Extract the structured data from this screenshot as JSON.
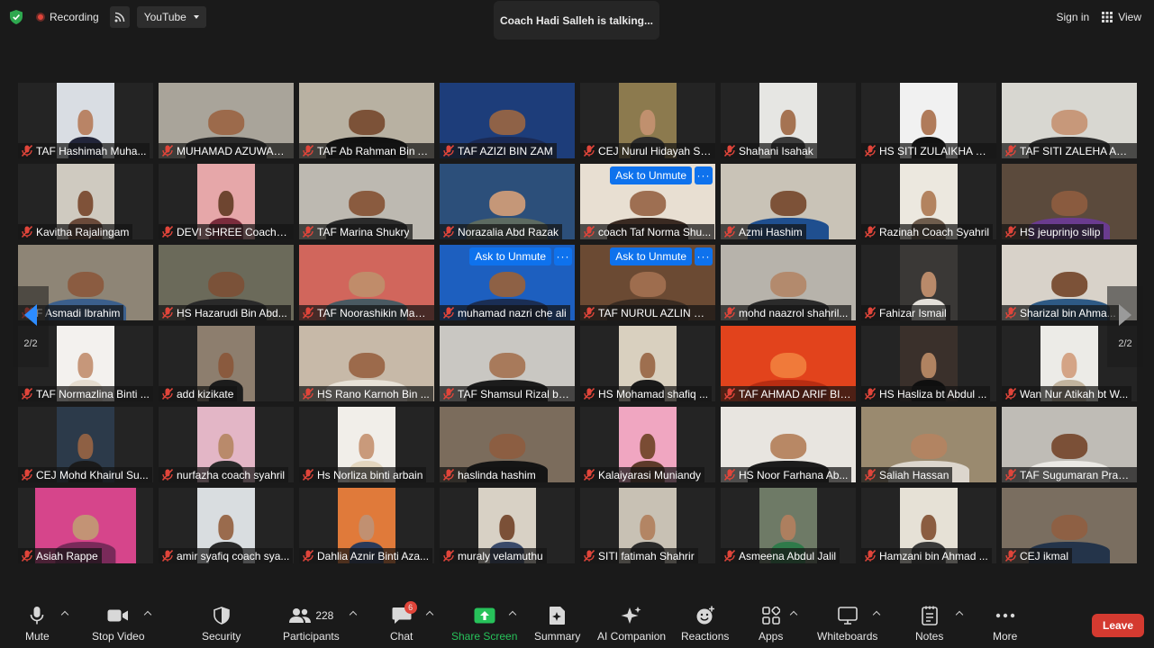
{
  "topbar": {
    "recording_label": "Recording",
    "stream_label": "YouTube",
    "talking": "Coach Hadi Salleh is talking...",
    "signin": "Sign in",
    "view": "View"
  },
  "pager": {
    "left_label": "2/2",
    "right_label": "2/2"
  },
  "tiles": [
    {
      "name": "TAF Hashimah Muha...",
      "w": "w-narrow",
      "bg": "#d9dde3",
      "skin": "#b98466",
      "cloth": "#22253a"
    },
    {
      "name": "MUHAMAD AZUWAN...",
      "w": "w-full",
      "bg": "#a9a49a",
      "skin": "#9c6a4b",
      "cloth": "#2a2a2a"
    },
    {
      "name": "TAF Ab Rahman Bin A...",
      "w": "w-full",
      "bg": "#b8b1a2",
      "skin": "#7c5238",
      "cloth": "#111111"
    },
    {
      "name": "TAF AZIZI BIN ZAM",
      "w": "w-full",
      "bg": "#1d3d7a",
      "skin": "#8f6247",
      "cloth": "#1a2a55"
    },
    {
      "name": "CEJ Nurul Hidayah Su...",
      "w": "w-narrow",
      "bg": "#8c7a4e",
      "skin": "#c0906e",
      "cloth": "#2b2b2b"
    },
    {
      "name": "Shahani Isahak",
      "w": "w-narrow",
      "bg": "#e6e6e3",
      "skin": "#a57352",
      "cloth": "#3b3b3b"
    },
    {
      "name": "HS SITI ZULAIKHA MA...",
      "w": "w-narrow",
      "bg": "#f1f1f1",
      "skin": "#b07b5a",
      "cloth": "#121212"
    },
    {
      "name": "TAF SITI ZALEHA ABD...",
      "w": "w-full",
      "bg": "#d8d7d1",
      "skin": "#c7987a",
      "cloth": "#2c2c2c"
    },
    {
      "name": "Kavitha Rajalingam",
      "w": "w-narrow",
      "bg": "#cfcac0",
      "skin": "#7f5239",
      "cloth": "#6b4a3a"
    },
    {
      "name": "DEVI  SHREE Coach S...",
      "w": "w-narrow",
      "bg": "#e6a7a9",
      "skin": "#6e4530",
      "cloth": "#7a2c3c"
    },
    {
      "name": "TAF Marina Shukry",
      "w": "w-full",
      "bg": "#bdb9b1",
      "skin": "#8a5b3f",
      "cloth": "#2b2b2b"
    },
    {
      "name": "Norazalia Abd Razak",
      "w": "w-full",
      "bg": "#2c4f7a",
      "skin": "#c59778",
      "cloth": "#5d6b61"
    },
    {
      "name": "coach Taf Norma Shu...",
      "w": "w-full",
      "bg": "#e8dfd2",
      "skin": "#9e6f52",
      "cloth": "#3a2a22",
      "unmute": true
    },
    {
      "name": "Azmi Hashim",
      "w": "w-full",
      "bg": "#c9c3b7",
      "skin": "#7d5238",
      "cloth": "#1f4f8f"
    },
    {
      "name": "Razinah Coach Syahril",
      "w": "w-narrow",
      "bg": "#ece8df",
      "skin": "#b3835f",
      "cloth": "#6f5d4d"
    },
    {
      "name": "HS jeuprinjo silip",
      "w": "w-full",
      "bg": "#5b4a3c",
      "skin": "#8a5b3f",
      "cloth": "#6a3b8f"
    },
    {
      "name": "F Asmadi Ibrahim",
      "w": "w-full",
      "bg": "#8e8576",
      "skin": "#8b5c41",
      "cloth": "#3b5f8c"
    },
    {
      "name": "HS Hazarudi Bin Abd...",
      "w": "w-full",
      "bg": "#6b6a5a",
      "skin": "#7b5239",
      "cloth": "#2a2a2a"
    },
    {
      "name": "TAF Noorashikin Mazl...",
      "w": "w-full",
      "bg": "#d1665c",
      "skin": "#c08c6a",
      "cloth": "#4a5a62"
    },
    {
      "name": "muhamad nazri che ali",
      "w": "w-full",
      "bg": "#1d5fbf",
      "skin": "#8e6145",
      "cloth": "#1a2e55",
      "unmute": true
    },
    {
      "name": "TAF NURUL AZLIN BT ...",
      "w": "w-full",
      "bg": "#6b4a33",
      "skin": "#9e6d4e",
      "cloth": "#3a2c22",
      "unmute": true
    },
    {
      "name": "mohd naazrol shahril...",
      "w": "w-full",
      "bg": "#b7b3ab",
      "skin": "#b38a6d",
      "cloth": "#2b2b2b"
    },
    {
      "name": "Fahizar Ismail",
      "w": "w-narrow",
      "bg": "#3a3836",
      "skin": "#b98a6a",
      "cloth": "#e4e0da"
    },
    {
      "name": "Sharizal bin Ahma...",
      "w": "w-full",
      "bg": "#d8d2c9",
      "skin": "#7c5238",
      "cloth": "#2e5a85"
    },
    {
      "name": "TAF Normazlina Binti ...",
      "w": "w-narrow",
      "bg": "#f3f1ee",
      "skin": "#c6977a",
      "cloth": "#e5dccf"
    },
    {
      "name": "add kizikate",
      "w": "w-narrow",
      "bg": "#8d7e6e",
      "skin": "#8a5a3e",
      "cloth": "#1c1c1c"
    },
    {
      "name": "HS Rano Karnoh Bin ...",
      "w": "w-full",
      "bg": "#c7b9a8",
      "skin": "#9c6a4b",
      "cloth": "#e8e2d8"
    },
    {
      "name": "TAF Shamsul Rizal bin...",
      "w": "w-full",
      "bg": "#c9c7c2",
      "skin": "#a87a5b",
      "cloth": "#1c1c1c"
    },
    {
      "name": "HS Mohamad shafiq ...",
      "w": "w-narrow",
      "bg": "#d9d0bf",
      "skin": "#9e6f4f",
      "cloth": "#1a1a1a"
    },
    {
      "name": "TAF AHMAD ARIF BIN...",
      "w": "w-full",
      "bg": "#e2431c",
      "skin": "#f07a3a",
      "cloth": "#b82d12"
    },
    {
      "name": "HS Hasliza bt Abdul ...",
      "w": "w-narrow",
      "bg": "#3a302b",
      "skin": "#b08361",
      "cloth": "#0f0f0f"
    },
    {
      "name": "Wan Nur Atikah bt W...",
      "w": "w-narrow",
      "bg": "#ecebe7",
      "skin": "#d4a486",
      "cloth": "#c2b49e"
    },
    {
      "name": "CEJ Mohd Khairul Su...",
      "w": "w-narrow",
      "bg": "#2c3a4a",
      "skin": "#8e6044",
      "cloth": "#1b1b1b"
    },
    {
      "name": "nurfazha coach syahril",
      "w": "w-narrow",
      "bg": "#e3b6c6",
      "skin": "#b98a6b",
      "cloth": "#2a2a2a"
    },
    {
      "name": "Hs Norliza binti arbain",
      "w": "w-narrow",
      "bg": "#f1eee9",
      "skin": "#c99a7b",
      "cloth": "#e3d6bf"
    },
    {
      "name": "haslinda hashim",
      "w": "w-full",
      "bg": "#7b6c5c",
      "skin": "#8c5e42",
      "cloth": "#151515"
    },
    {
      "name": "Kalaiyarasi Muniandy",
      "w": "w-narrow",
      "bg": "#f0a6c1",
      "skin": "#7a4c34",
      "cloth": "#5d3a2a"
    },
    {
      "name": "HS Noor Farhana Ab...",
      "w": "w-full",
      "bg": "#e8e5e0",
      "skin": "#b88865",
      "cloth": "#1c1c1c"
    },
    {
      "name": "Saliah Hassan",
      "w": "w-full",
      "bg": "#9a8a6f",
      "skin": "#b28462",
      "cloth": "#dcd6cd"
    },
    {
      "name": "TAF Sugumaran Prakh...",
      "w": "w-full",
      "bg": "#bfbcb6",
      "skin": "#7b5037",
      "cloth": "#ebe9e5"
    },
    {
      "name": "Asiah Rappe",
      "w": "w-mid",
      "bg": "#d6458b",
      "skin": "#c39375",
      "cloth": "#7a2a5a"
    },
    {
      "name": "amir syafiq coach sya...",
      "w": "w-narrow",
      "bg": "#d9dde0",
      "skin": "#9a6b4d",
      "cloth": "#2a2a2a"
    },
    {
      "name": "Dahlia Aznir Binti Aza...",
      "w": "w-narrow",
      "bg": "#e07a3a",
      "skin": "#c19071",
      "cloth": "#2b3a5a"
    },
    {
      "name": "muraly velamuthu",
      "w": "w-narrow",
      "bg": "#d8d1c5",
      "skin": "#7b5037",
      "cloth": "#3a4a6a"
    },
    {
      "name": "SITI fatimah Shahrir",
      "w": "w-narrow",
      "bg": "#c8c1b4",
      "skin": "#b38564",
      "cloth": "#2b2b2b"
    },
    {
      "name": "Asmeena Abdul Jalil",
      "w": "w-narrow",
      "bg": "#6e7a66",
      "skin": "#ad7f5f",
      "cloth": "#2f7a4a"
    },
    {
      "name": "Hamzani bin Ahmad ...",
      "w": "w-narrow",
      "bg": "#e6e1d6",
      "skin": "#8b5d41",
      "cloth": "#3a3a3a"
    },
    {
      "name": "CEJ ikmal",
      "w": "w-full",
      "bg": "#7a6e60",
      "skin": "#8e6044",
      "cloth": "#24344a"
    }
  ],
  "unmute": {
    "label": "Ask to Unmute",
    "more": "···"
  },
  "toolbar": {
    "mute": "Mute",
    "stop_video": "Stop Video",
    "security": "Security",
    "participants": "Participants",
    "participants_count": "228",
    "chat": "Chat",
    "chat_badge": "6",
    "share_screen": "Share Screen",
    "summary": "Summary",
    "ai_companion": "AI Companion",
    "reactions": "Reactions",
    "apps": "Apps",
    "whiteboards": "Whiteboards",
    "notes": "Notes",
    "more": "More",
    "leave": "Leave"
  },
  "colors": {
    "background": "#1a1a1a",
    "accent_blue": "#0e72ed",
    "share_green": "#27c25a",
    "leave_red": "#d43a30",
    "muted_red": "#e0453a"
  }
}
